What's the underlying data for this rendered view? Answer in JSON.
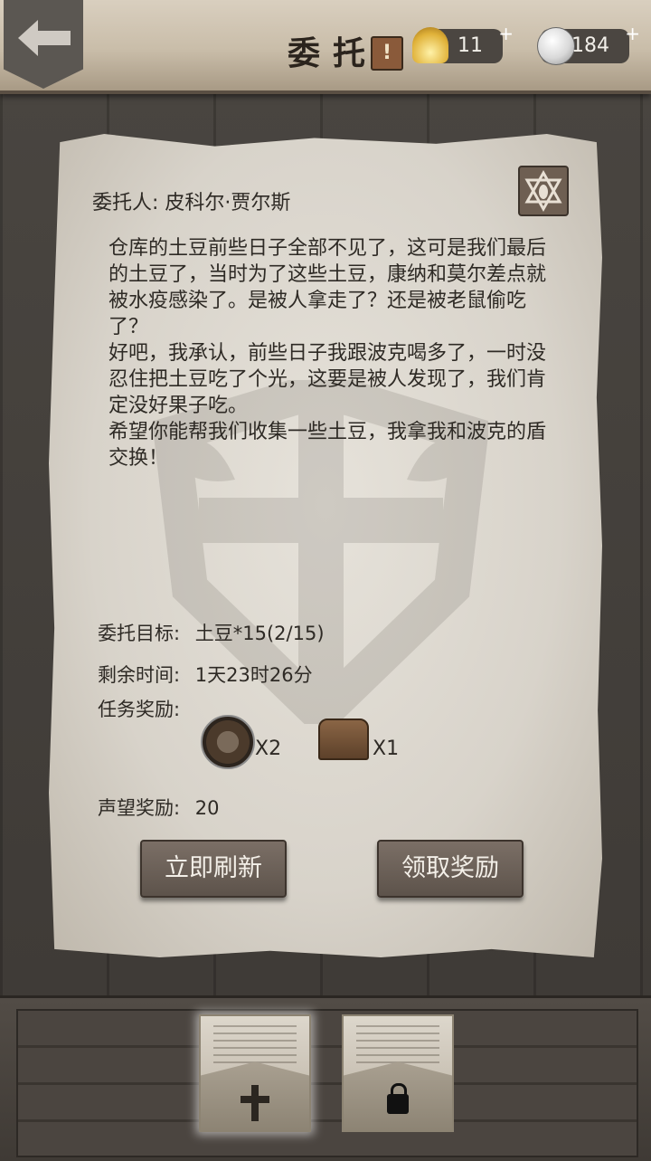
{
  "header": {
    "title": "委托",
    "alert": "!",
    "shells": "11",
    "coins": "184",
    "plus": "+"
  },
  "quest": {
    "client_label": "委托人: 皮科尔·贾尔斯",
    "story": "仓库的土豆前些日子全部不见了，这可是我们最后的土豆了，当时为了这些土豆，康纳和莫尔差点就被水疫感染了。是被人拿走了？还是被老鼠偷吃了？\n好吧，我承认，前些日子我跟波克喝多了，一时没忍住把土豆吃了个光，这要是被人发现了，我们肯定没好果子吃。\n希望你能帮我们收集一些土豆，我拿我和波克的盾交换！",
    "target_label": "委托目标:",
    "target_value": "土豆*15(2/15)",
    "time_label": "剩余时间:",
    "time_value": "1天23时26分",
    "rewards_label": "任务奖励:",
    "rewards": [
      {
        "icon": "shield-icon",
        "qty": "X2"
      },
      {
        "icon": "chest-icon",
        "qty": "X1"
      }
    ],
    "reputation_label": "声望奖励:",
    "reputation_value": "20"
  },
  "buttons": {
    "refresh": "立即刷新",
    "claim": "领取奖励"
  }
}
